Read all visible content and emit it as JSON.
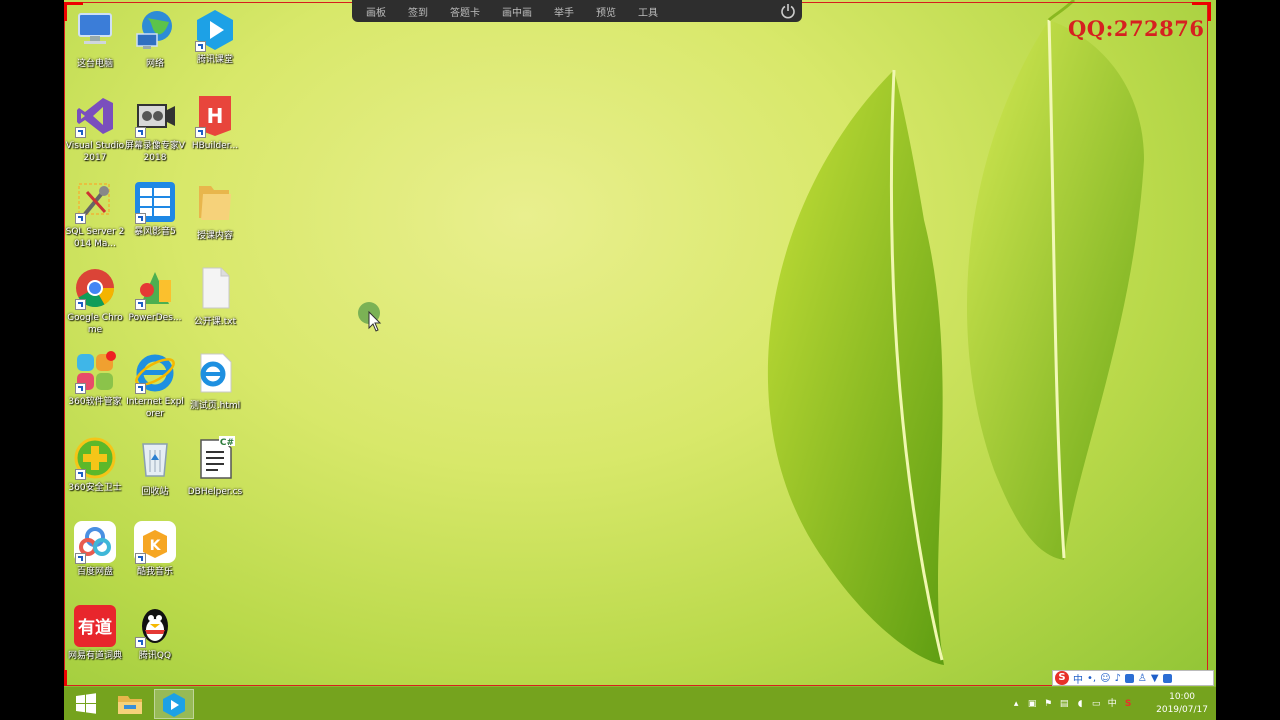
{
  "toolbar": {
    "items": [
      "画板",
      "签到",
      "答题卡",
      "画中画",
      "举手",
      "预览",
      "工具"
    ],
    "active_index": 6,
    "power_icon": "power-icon"
  },
  "watermark": "QQ:272876",
  "desktop_icons": [
    {
      "label": "这台电脑",
      "icon": "computer-icon",
      "shortcut": false
    },
    {
      "label": "网络",
      "icon": "network-globe-icon",
      "shortcut": false
    },
    {
      "label": "腾讯课堂",
      "icon": "tencent-classroom-icon",
      "shortcut": true
    },
    {
      "label": "Visual Studio 2017",
      "icon": "visual-studio-icon",
      "shortcut": true
    },
    {
      "label": "屏幕录像专家V2018",
      "icon": "film-camera-icon",
      "shortcut": true
    },
    {
      "label": "HBuilder...",
      "icon": "hbuilder-icon",
      "shortcut": true
    },
    {
      "label": "SQL Server 2014 Ma...",
      "icon": "sql-server-tools-icon",
      "shortcut": true
    },
    {
      "label": "暴风影音5",
      "icon": "storm-player-icon",
      "shortcut": true
    },
    {
      "label": "授课内容",
      "icon": "folder-icon",
      "shortcut": false
    },
    {
      "label": "Google Chrome",
      "icon": "chrome-icon",
      "shortcut": true
    },
    {
      "label": "PowerDes...",
      "icon": "powerdesigner-icon",
      "shortcut": true
    },
    {
      "label": "公开课.txt",
      "icon": "text-file-icon",
      "shortcut": false
    },
    {
      "label": "360软件管家",
      "icon": "software-manager-icon",
      "shortcut": true
    },
    {
      "label": "Internet Explorer",
      "icon": "internet-explorer-icon",
      "shortcut": true
    },
    {
      "label": "测试页.html",
      "icon": "html-file-icon",
      "shortcut": false
    },
    {
      "label": "360安全卫士",
      "icon": "security-guard-icon",
      "shortcut": true
    },
    {
      "label": "回收站",
      "icon": "recycle-bin-icon",
      "shortcut": false
    },
    {
      "label": "DBHelper.cs",
      "icon": "csharp-file-icon",
      "shortcut": false
    },
    {
      "label": "百度网盘",
      "icon": "baidu-netdisk-icon",
      "shortcut": true
    },
    {
      "label": "酷我音乐",
      "icon": "kuwo-music-icon",
      "shortcut": true
    },
    {
      "label": "网易有道词典",
      "icon": "youdao-dict-icon",
      "shortcut": true
    },
    {
      "label": "腾讯QQ",
      "icon": "qq-penguin-icon",
      "shortcut": true
    }
  ],
  "taskbar": {
    "start": "windows-start-icon",
    "pinned": [
      "file-explorer-icon",
      "tencent-classroom-icon"
    ],
    "tray_icons": [
      "chevron-up-icon",
      "tray-app-icon",
      "network-icon",
      "volume-icon",
      "ime-icon",
      "sogou-icon"
    ],
    "tray_ime_char": "中",
    "time": "10:00",
    "date": "2019/07/17"
  },
  "ime_bar": {
    "logo": "S",
    "mode": "中"
  },
  "colors": {
    "recording_red": "#d61e1e",
    "taskbar": "#75a31e",
    "wallpaper": "#d8e86a"
  }
}
